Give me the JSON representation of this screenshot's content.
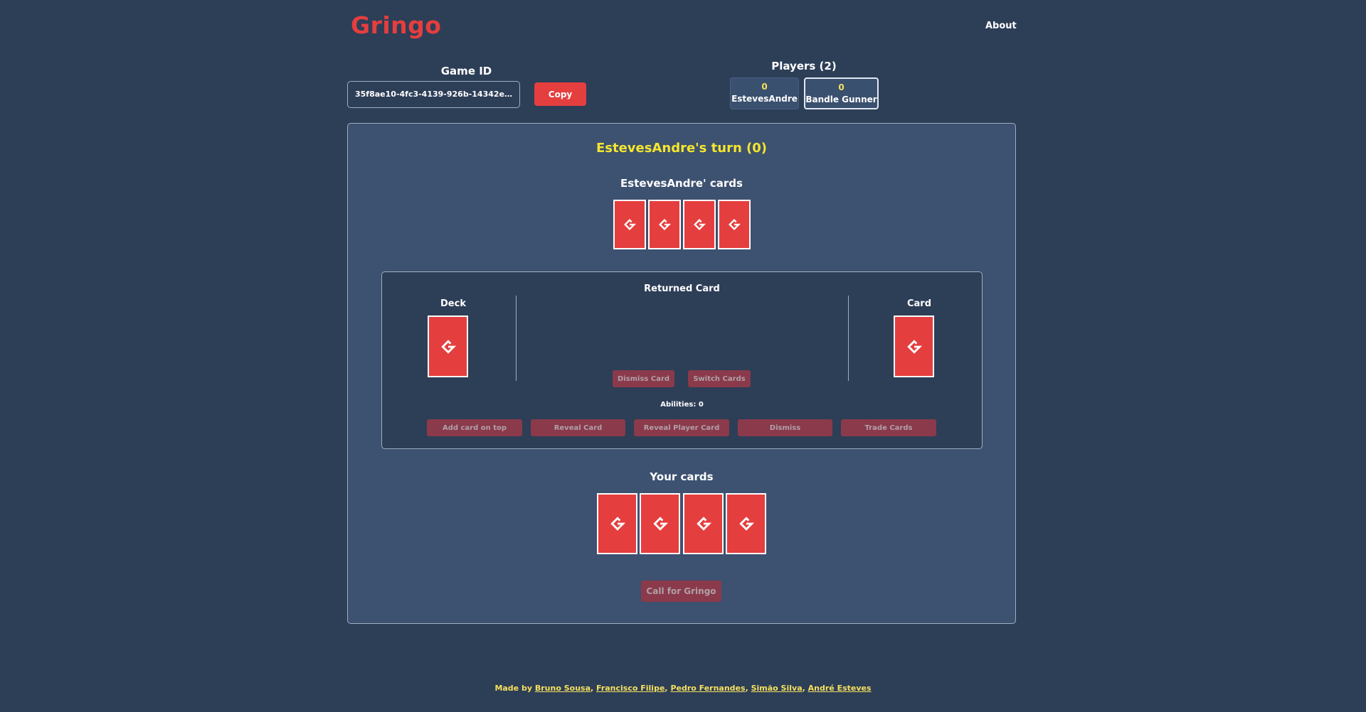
{
  "header": {
    "logo": "Gringo",
    "about_label": "About"
  },
  "game": {
    "id_label": "Game ID",
    "id_value": "35f8ae10-4fc3-4139-926b-14342e7...",
    "copy_label": "Copy"
  },
  "players": {
    "label": "Players (2)",
    "list": [
      {
        "score": "0",
        "name": "EstevesAndre",
        "active": false
      },
      {
        "score": "0",
        "name": "Bandle Gunner",
        "active": true
      }
    ]
  },
  "board": {
    "turn_text": "EstevesAndre's turn (0)",
    "opponent_cards_label": "EstevesAndre' cards",
    "opponent_card_count": 4,
    "deck_label": "Deck",
    "returned_card_label": "Returned Card",
    "card_label": "Card",
    "dismiss_card_label": "Dismiss Card",
    "switch_cards_label": "Switch Cards",
    "abilities_text": "Abilities: 0",
    "ability_buttons": [
      "Add card on top",
      "Reveal Card",
      "Reveal Player Card",
      "Dismiss",
      "Trade Cards"
    ],
    "your_cards_label": "Your cards",
    "your_card_count": 4,
    "call_gringo_label": "Call for Gringo"
  },
  "footer": {
    "prefix": "Made by ",
    "authors": [
      "Bruno Sousa",
      "Francisco Filipe",
      "Pedro Fernandes",
      "Simão Silva",
      "André Esteves"
    ]
  },
  "colors": {
    "background": "#2d3e57",
    "panel": "#3d5170",
    "accent_red": "#e53e3e",
    "turn_yellow": "#f6e62d",
    "disabled_button": "#8a3a4b"
  }
}
